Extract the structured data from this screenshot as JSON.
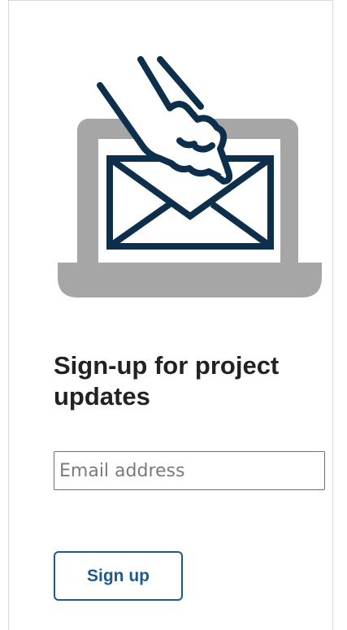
{
  "signup": {
    "heading": "Sign-up for project updates",
    "email_placeholder": "Email address",
    "email_value": "",
    "button_label": "Sign up"
  },
  "illustration": {
    "icon": "laptop-envelope-hand-icon",
    "colors": {
      "laptop": "#a6a6a6",
      "screen": "#ffffff",
      "envelope_outline": "#0d2f4c",
      "hand_outline": "#0d2f4c"
    }
  },
  "colors": {
    "heading_text": "#222222",
    "button_accent": "#1e5a8e",
    "input_border": "#6f6f6f"
  }
}
